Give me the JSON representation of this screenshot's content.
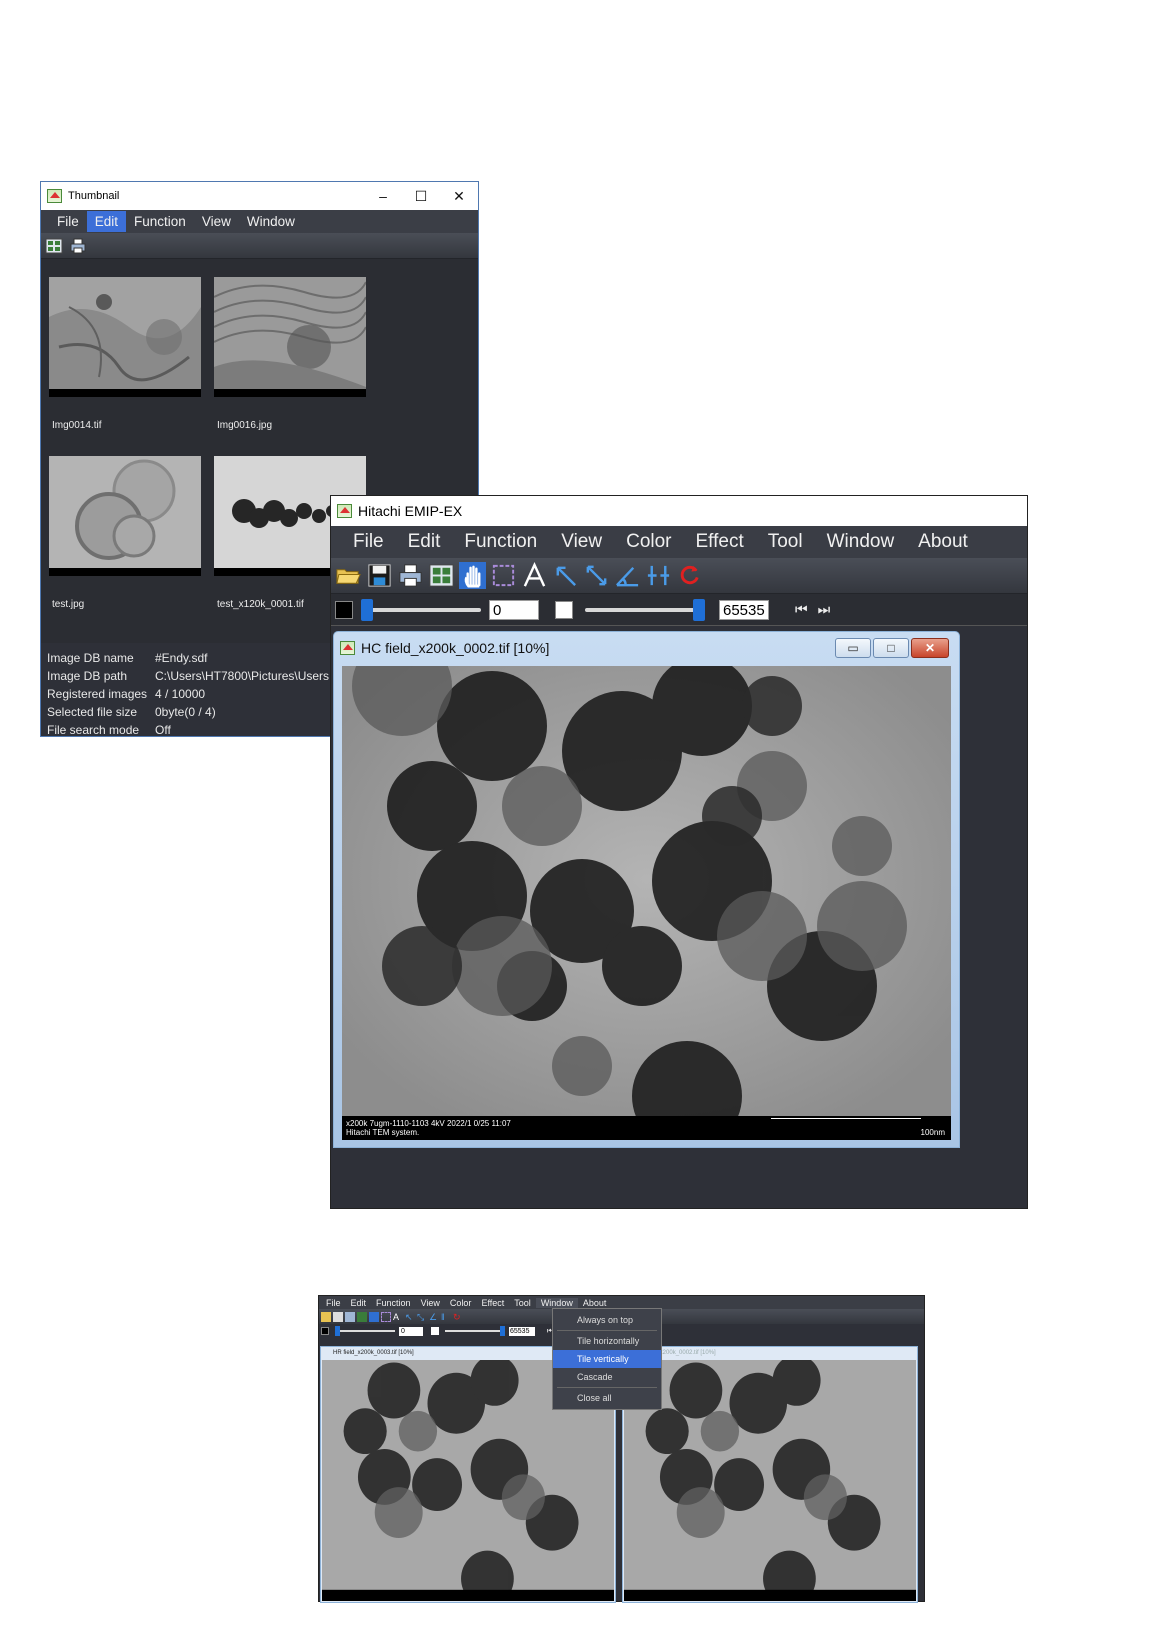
{
  "thumbnail_window": {
    "title": "Thumbnail",
    "controls": {
      "minimize": "–",
      "maximize": "☐",
      "close": "✕"
    },
    "menu": [
      "File",
      "Edit",
      "Function",
      "View",
      "Window"
    ],
    "active_menu": "Edit",
    "thumbnails": [
      {
        "label": "Img0014.tif"
      },
      {
        "label": "Img0016.jpg"
      },
      {
        "label": "test.jpg"
      },
      {
        "label": "test_x120k_0001.tif"
      }
    ],
    "info": {
      "db_name_label": "Image DB name",
      "db_name": "#Endy.sdf",
      "db_path_label": "Image DB path",
      "db_path": "C:\\Users\\HT7800\\Pictures\\Users",
      "registered_label": "Registered images",
      "registered": "4 / 10000",
      "filesize_label": "Selected file size",
      "filesize": "0byte(0 / 4)",
      "search_label": "File search mode",
      "search": "Off"
    }
  },
  "main_window": {
    "title": "Hitachi EMIP-EX",
    "menu": [
      "File",
      "Edit",
      "Function",
      "View",
      "Color",
      "Effect",
      "Tool",
      "Window",
      "About"
    ],
    "toolbar_icons": [
      "open-folder-icon",
      "save-icon",
      "print-icon",
      "thumbnail-icon",
      "hand-icon",
      "select-rect-icon",
      "text-icon",
      "arrow-icon",
      "measure-icon",
      "angle-icon",
      "scale-icon",
      "rotate-icon"
    ],
    "contrast": {
      "low_value": "0",
      "high_value": "65535",
      "low_fraction": 0.0,
      "high_fraction": 1.0
    },
    "image_window": {
      "title": "HC field_x200k_0002.tif [10%]",
      "caption_line1": "x200k 7ugm-1110-1103 4kV 2022/1 0/25 11:07",
      "caption_line2": "Hitachi TEM system.",
      "scale_bar": "100nm"
    }
  },
  "bottom_screenshot": {
    "menu": [
      "File",
      "Edit",
      "Function",
      "View",
      "Color",
      "Effect",
      "Tool",
      "Window",
      "About"
    ],
    "active_menu": "Window",
    "low_value": "0",
    "high_value": "65535",
    "window_menu": {
      "items": [
        "Always on top",
        "Tile horizontally",
        "Tile vertically",
        "Cascade",
        "Close all"
      ],
      "selected": "Tile vertically"
    },
    "left_title": "HR field_x200k_0003.tif [10%]",
    "right_title": "HC field_x200k_0002.tif [10%]"
  }
}
